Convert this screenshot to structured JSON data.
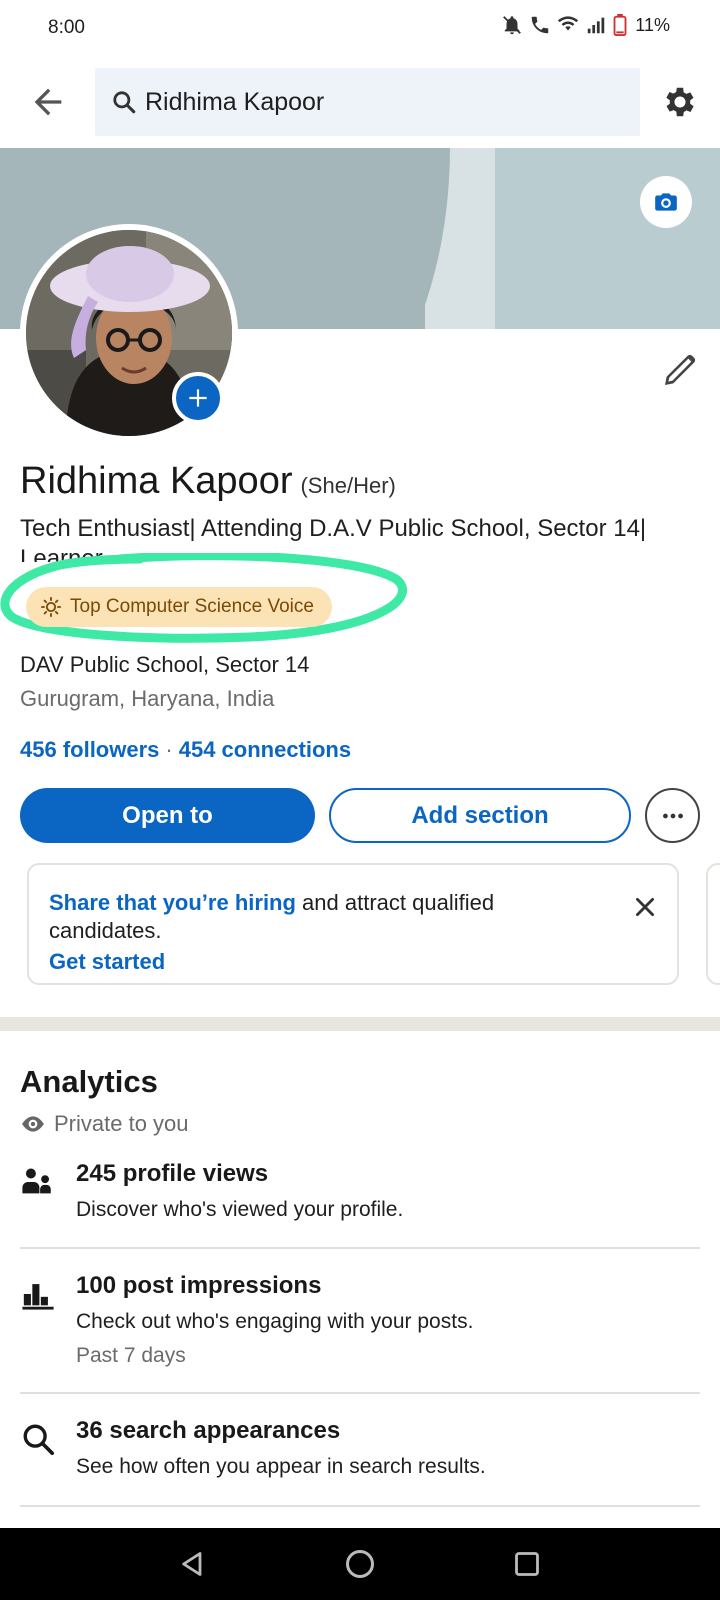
{
  "status_bar": {
    "time": "8:00",
    "battery": "11%",
    "icons": [
      "mute-icon",
      "call-icon",
      "wifi-icon",
      "signal-icon",
      "battery-icon"
    ]
  },
  "top_bar": {
    "search_text": "Ridhima Kapoor",
    "icons": [
      "back-arrow-icon",
      "search-icon",
      "settings-gear-icon"
    ]
  },
  "profile": {
    "name": "Ridhima Kapoor",
    "pronouns": "(She/Her)",
    "headline": "Tech Enthusiast| Attending D.A.V Public School, Sector 14| Learner",
    "badge": "Top Computer Science Voice",
    "school": "DAV Public School, Sector 14",
    "location": "Gurugram, Haryana, India",
    "followers": "456 followers",
    "separator": "·",
    "connections": "454 connections"
  },
  "actions": {
    "open_to": "Open to",
    "add_section": "Add section"
  },
  "hiring_card": {
    "link_text": "Share that you’re hiring",
    "text": " and attract qualified candidates.",
    "cta": "Get started"
  },
  "analytics": {
    "title": "Analytics",
    "privacy": "Private to you",
    "items": [
      {
        "icon": "people-icon",
        "title": "245 profile views",
        "subtitle": "Discover who's viewed your profile.",
        "note": ""
      },
      {
        "icon": "bar-chart-icon",
        "title": "100 post impressions",
        "subtitle": "Check out who's engaging with your posts.",
        "note": "Past 7 days"
      },
      {
        "icon": "search-icon",
        "title": "36 search appearances",
        "subtitle": "See how often you appear in search results.",
        "note": ""
      }
    ]
  },
  "colors": {
    "brand_blue": "#0a66c2",
    "badge_bg": "#fbe3b6",
    "badge_text": "#7a4a05",
    "highlight_green": "#3ee8a5"
  }
}
